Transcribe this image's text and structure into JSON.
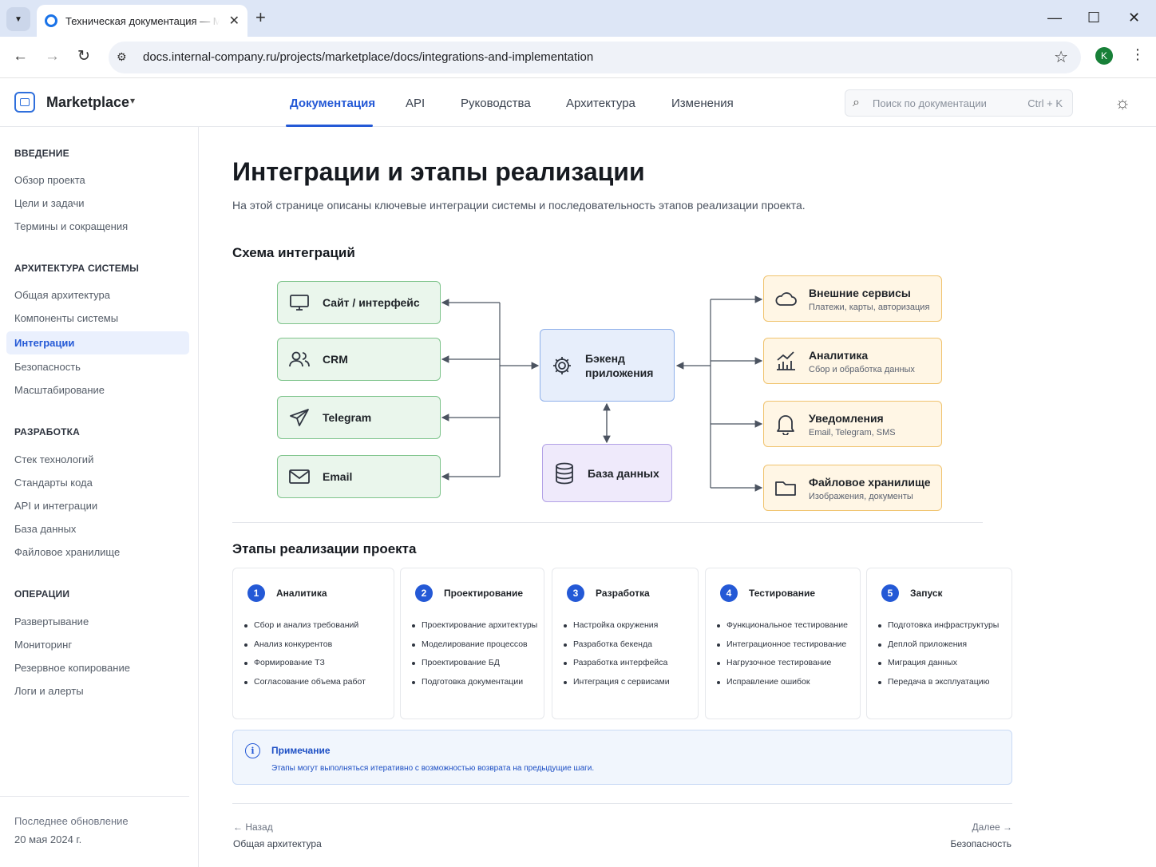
{
  "browser": {
    "tab_title": "Техническая документация — Marketplace",
    "url": "docs.internal-company.ru/projects/marketplace/docs/integrations-and-implementation",
    "profile_initial": "K"
  },
  "header": {
    "brand": "Marketplace",
    "nav": [
      "Документация",
      "API",
      "Руководства",
      "Архитектура",
      "Изменения"
    ],
    "active_nav": "Документация",
    "search_placeholder": "Поиск по документации",
    "search_shortcut": "Ctrl + K"
  },
  "sidebar": {
    "sections": [
      {
        "title": "ВВЕДЕНИЕ",
        "items": [
          "Обзор проекта",
          "Цели и задачи",
          "Термины и сокращения"
        ]
      },
      {
        "title": "АРХИТЕКТУРА СИСТЕМЫ",
        "items": [
          "Общая архитектура",
          "Компоненты системы",
          "Интеграции",
          "Безопасность",
          "Масштабирование"
        ]
      },
      {
        "title": "РАЗРАБОТКА",
        "items": [
          "Стек технологий",
          "Стандарты кода",
          "API и интеграции",
          "База данных",
          "Файловое хранилище"
        ]
      },
      {
        "title": "ОПЕРАЦИИ",
        "items": [
          "Развертывание",
          "Мониторинг",
          "Резервное копирование",
          "Логи и алерты"
        ]
      }
    ],
    "active_item": "Интеграции",
    "footer_label": "Последнее обновление",
    "footer_date": "20 мая 2024 г."
  },
  "page": {
    "title": "Интеграции и этапы реализации",
    "lead": "На этой странице описаны ключевые интеграции системы и последовательность этапов реализации проекта.",
    "diagram_heading": "Схема интеграций",
    "stages_heading": "Этапы реализации проекта"
  },
  "diagram": {
    "clients": [
      {
        "label": "Сайт / интерфейс",
        "icon": "monitor-icon"
      },
      {
        "label": "CRM",
        "icon": "users-icon"
      },
      {
        "label": "Telegram",
        "icon": "send-icon"
      },
      {
        "label": "Email",
        "icon": "mail-icon"
      }
    ],
    "backend": {
      "label_line1": "Бэкенд",
      "label_line2": "приложения",
      "icon": "gear-icon"
    },
    "database": {
      "label": "База данных",
      "icon": "database-icon"
    },
    "services": [
      {
        "title": "Внешние сервисы",
        "subtitle": "Платежи, карты, авторизация",
        "icon": "cloud-icon"
      },
      {
        "title": "Аналитика",
        "subtitle": "Сбор и обработка данных",
        "icon": "chart-icon"
      },
      {
        "title": "Уведомления",
        "subtitle": "Email, Telegram, SMS",
        "icon": "bell-icon"
      },
      {
        "title": "Файловое хранилище",
        "subtitle": "Изображения, документы",
        "icon": "folder-icon"
      }
    ]
  },
  "stages": [
    {
      "num": "1",
      "title": "Аналитика",
      "items": [
        "Сбор и анализ требований",
        "Анализ конкурентов",
        "Формирование ТЗ",
        "Согласование объема работ"
      ]
    },
    {
      "num": "2",
      "title": "Проектирование",
      "items": [
        "Проектирование архитектуры",
        "Моделирование процессов",
        "Проектирование БД",
        "Подготовка документации"
      ]
    },
    {
      "num": "3",
      "title": "Разработка",
      "items": [
        "Настройка окружения",
        "Разработка бекенда",
        "Разработка интерфейса",
        "Интеграция с сервисами"
      ]
    },
    {
      "num": "4",
      "title": "Тестирование",
      "items": [
        "Функциональное тестирование",
        "Интеграционное тестирование",
        "Нагрузочное тестирование",
        "Исправление ошибок"
      ]
    },
    {
      "num": "5",
      "title": "Запуск",
      "items": [
        "Подготовка инфраструктуры",
        "Деплой приложения",
        "Миграция данных",
        "Передача в эксплуатацию"
      ]
    }
  ],
  "note": {
    "title": "Примечание",
    "text": "Этапы могут выполняться итеративно с возможностью возврата на предыдущие шаги."
  },
  "pager": {
    "prev_label": "← Назад",
    "prev_title": "Общая архитектура",
    "next_label": "Далее →",
    "next_title": "Безопасность"
  }
}
